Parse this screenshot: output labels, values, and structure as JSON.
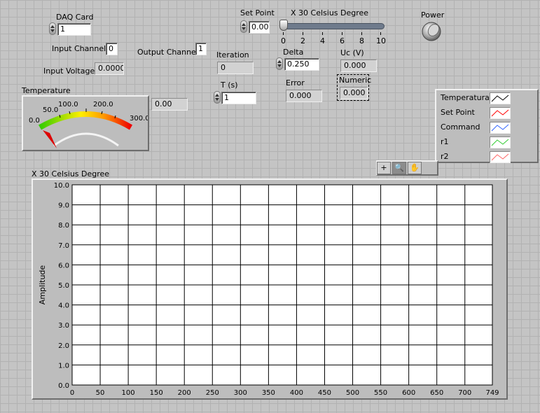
{
  "controls": {
    "daq_card": {
      "label": "DAQ Card",
      "value": "1"
    },
    "input_channel": {
      "label": "Input Channel",
      "value": "0"
    },
    "output_channel": {
      "label": "Output Channel",
      "value": "1"
    },
    "input_voltage": {
      "label": "Input Voltage",
      "value": "0.0000"
    },
    "set_point": {
      "label": "Set Point",
      "value": "0.00"
    },
    "slider": {
      "label": "X 30 Celsius Degree",
      "ticks": [
        "0",
        "2",
        "4",
        "6",
        "8",
        "10"
      ],
      "value": 0
    },
    "iteration": {
      "label": "Iteration",
      "value": "0"
    },
    "t_s": {
      "label": "T (s)",
      "value": "1"
    },
    "delta": {
      "label": "Delta",
      "value": "0.250"
    },
    "error": {
      "label": "Error",
      "value": "0.000"
    },
    "uc": {
      "label": "Uc  (V)",
      "value": "0.000"
    },
    "numeric": {
      "label": "Numeric",
      "value": "0.000"
    },
    "power": {
      "label": "Power"
    }
  },
  "gauge": {
    "label": "Temperature",
    "scale_labels": [
      "0.0",
      "50.0",
      "100.0",
      "200.0",
      "300.0"
    ],
    "value": 0,
    "readout": "0.00"
  },
  "legend": {
    "items": [
      {
        "label": "Temperatura",
        "color": "#000000"
      },
      {
        "label": "Set Point",
        "color": "#ff0000"
      },
      {
        "label": "Command",
        "color": "#3366ff"
      },
      {
        "label": "r1",
        "color": "#33cc33"
      },
      {
        "label": "r2",
        "color": "#ff6666"
      }
    ]
  },
  "graph_tools": [
    "+",
    "🔍",
    "✋"
  ],
  "chart_data": {
    "type": "line",
    "title": "X  30 Celsius Degree",
    "xlabel": "",
    "ylabel": "Amplitude",
    "xlim": [
      0,
      749
    ],
    "ylim": [
      0,
      10
    ],
    "x_ticks": [
      "0",
      "50",
      "100",
      "150",
      "200",
      "250",
      "300",
      "350",
      "400",
      "450",
      "500",
      "550",
      "600",
      "650",
      "700",
      "749"
    ],
    "y_ticks": [
      "0.0",
      "1.0",
      "2.0",
      "3.0",
      "4.0",
      "5.0",
      "6.0",
      "7.0",
      "8.0",
      "9.0",
      "10.0"
    ],
    "grid": true,
    "series": []
  }
}
